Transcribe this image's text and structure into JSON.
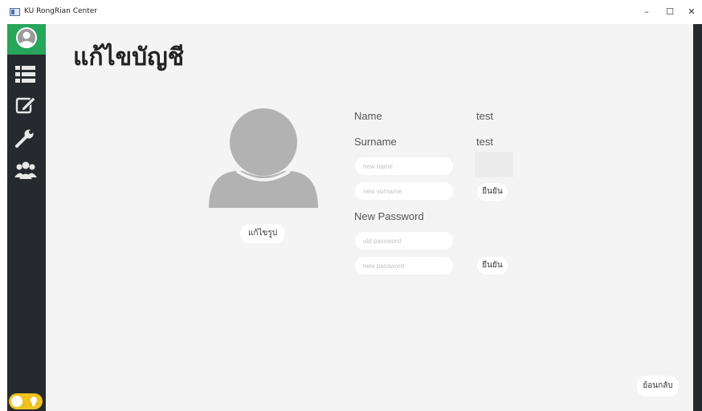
{
  "window": {
    "title": "KU RongRian Center",
    "minimize": "–",
    "maximize": "☐",
    "close": "✕"
  },
  "page": {
    "title": "แก้ไขบัญชี"
  },
  "profile": {
    "edit_photo_label": "แก้ไขรูป"
  },
  "info": {
    "name_label": "Name",
    "name_value": "test",
    "surname_label": "Surname",
    "surname_value": "test"
  },
  "rename": {
    "new_name_placeholder": "new name",
    "new_surname_placeholder": "new surname",
    "confirm_label": "ยืนยัน"
  },
  "password": {
    "heading": "New Password",
    "old_placeholder": "old password",
    "new_placeholder": "new password",
    "confirm_label": "ยืนยัน"
  },
  "footer": {
    "back_label": "ย้อนกลับ"
  },
  "sidebar": {
    "icons": [
      "user-icon",
      "list-icon",
      "edit-icon",
      "wrench-icon",
      "group-icon"
    ],
    "toggle_icon": "lightbulb-icon"
  },
  "colors": {
    "sidebar": "#262a2e",
    "active": "#27a55b",
    "toggle": "#f0c21d",
    "background": "#f4f4f4"
  }
}
